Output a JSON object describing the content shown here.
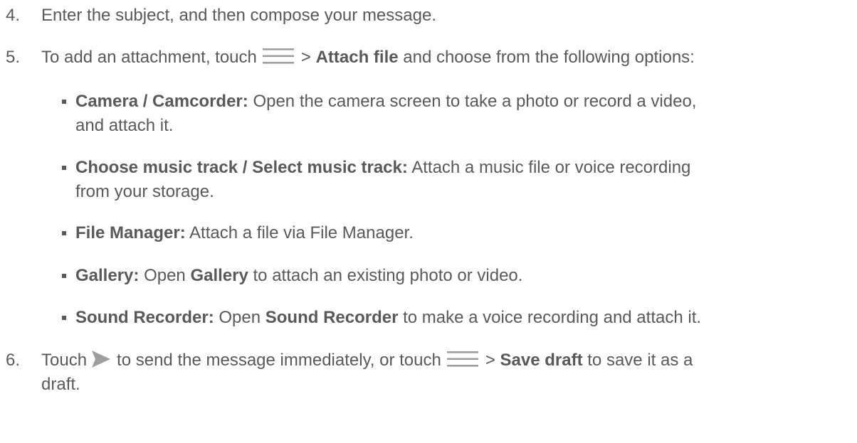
{
  "steps": {
    "s4": {
      "num": "4.",
      "text": "Enter the subject, and then compose your message."
    },
    "s5": {
      "num": "5.",
      "pre": "To add an attachment, touch",
      "sep": ">",
      "bold": "Attach file",
      "post": "and choose from the following options:"
    },
    "s6": {
      "num": "6.",
      "pre": "Touch",
      "mid": "to send the message immediately, or touch",
      "sep": ">",
      "bold": "Save draft",
      "post": "to save it as a",
      "post2": "draft."
    }
  },
  "options": [
    {
      "term": "Camera / Camcorder:",
      "line1": "Open the camera screen to take a photo or record a video,",
      "line2": "and attach it."
    },
    {
      "term": "Choose music track / Select music track:",
      "line1": "Attach a music file or voice recording",
      "line2": "from your storage."
    },
    {
      "term": "File Manager:",
      "desc": "Attach a file via File Manager."
    },
    {
      "term": "Gallery:",
      "pre": "Open",
      "bold": "Gallery",
      "post": "to attach an existing photo or video."
    },
    {
      "term": "Sound Recorder:",
      "pre": "Open",
      "bold": "Sound Recorder",
      "post": "to make a voice recording and attach it."
    }
  ],
  "icons": {
    "menu": "menu-icon",
    "send": "send-icon",
    "color": "#9e9e9e"
  }
}
